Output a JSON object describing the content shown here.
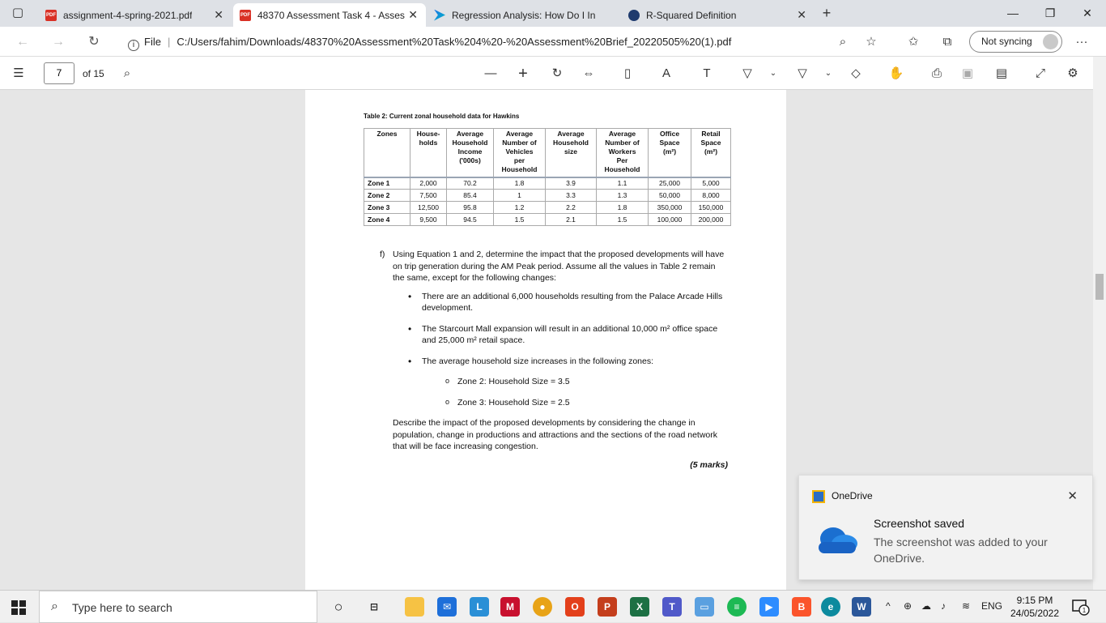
{
  "browser": {
    "tabs": [
      {
        "title": "assignment-4-spring-2021.pdf",
        "icon": "pdf-icon",
        "active": false
      },
      {
        "title": "48370 Assessment Task 4 - Asses",
        "icon": "pdf-icon",
        "active": true
      },
      {
        "title": "Regression Analysis: How Do I In",
        "icon": "bing-icon",
        "active": false
      },
      {
        "title": "R-Squared Definition",
        "icon": "investopedia-icon",
        "active": false
      }
    ],
    "url_prefix": "File",
    "url": "C:/Users/fahim/Downloads/48370%20Assessment%20Task%204%20-%20Assessment%20Brief_20220505%20(1).pdf",
    "sync_label": "Not syncing"
  },
  "pdf_toolbar": {
    "page_number": "7",
    "page_total": "of 15"
  },
  "document": {
    "table_caption": "Table 2: Current zonal household data for Hawkins",
    "table_headers": [
      "Zones",
      "House-\nholds",
      "Average\nHousehold\nIncome\n('000s)",
      "Average\nNumber of\nVehicles\nper\nHousehold",
      "Average\nHousehold\nsize",
      "Average\nNumber of\nWorkers\nPer\nHousehold",
      "Office\nSpace\n(m²)",
      "Retail\nSpace\n(m²)"
    ],
    "table_rows": [
      [
        "Zone 1",
        "2,000",
        "70.2",
        "1.8",
        "3.9",
        "1.1",
        "25,000",
        "5,000"
      ],
      [
        "Zone 2",
        "7,500",
        "85.4",
        "1",
        "3.3",
        "1.3",
        "50,000",
        "8,000"
      ],
      [
        "Zone 3",
        "12,500",
        "95.8",
        "1.2",
        "2.2",
        "1.8",
        "350,000",
        "150,000"
      ],
      [
        "Zone 4",
        "9,500",
        "94.5",
        "1.5",
        "2.1",
        "1.5",
        "100,000",
        "200,000"
      ]
    ],
    "question_tag": "f)",
    "question_text": "Using Equation 1 and 2, determine the impact that the proposed developments will have on trip generation during the AM Peak period. Assume all the values in Table 2 remain the same, except for the following changes:",
    "bullets": [
      "There are an additional 6,000 households resulting from the Palace Arcade Hills development.",
      "The Starcourt Mall expansion will result in an additional 10,000 m² office space and 25,000 m² retail space.",
      "The average household size increases in the following zones:"
    ],
    "sub_bullets": [
      "Zone 2: Household Size = 3.5",
      "Zone 3: Household Size = 2.5"
    ],
    "describe_text": "Describe the impact of the proposed developments by considering the change in population, change in productions and attractions and the sections of the road network that will be face increasing congestion.",
    "marks": "(5 marks)"
  },
  "toast": {
    "app_name": "OneDrive",
    "title": "Screenshot saved",
    "message": "The screenshot was added to your OneDrive."
  },
  "taskbar": {
    "search_placeholder": "Type here to search",
    "language": "ENG",
    "time": "9:15 PM",
    "date": "24/05/2022",
    "notification_count": "1"
  }
}
